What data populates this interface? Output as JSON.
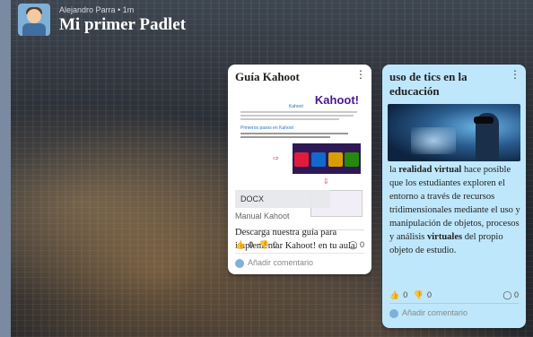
{
  "header": {
    "meta": "Alejandro Parra • 1m",
    "title": "Mi primer Padlet"
  },
  "cards": [
    {
      "title": "Guía Kahoot",
      "thumb_logo": "Kahoot!",
      "thumb_heading": "Kahoot",
      "thumb_sub": "Primeros pasos en Kahoot",
      "attachment_type": "DOCX",
      "attachment_name": "Manual Kahoot",
      "body": "Descarga nuestra guía para implementar Kahoot! en tu aula.",
      "likes": "0",
      "dislikes": "0",
      "comments": "0",
      "add_comment": "Añadir comentario"
    },
    {
      "title": "uso de tics en la educación",
      "body_parts": {
        "p1": "la ",
        "b1": "realidad virtual",
        "p2": " hace posible que los estudiantes exploren el entorno a través de recursos tridimensionales mediante el uso y manipulación de objetos, procesos y análisis ",
        "b2": "virtuales",
        "p3": " del propio objeto de estudio."
      },
      "likes": "0",
      "dislikes": "0",
      "comments": "0",
      "add_comment": "Añadir comentario"
    }
  ],
  "icons": {
    "menu": "more-vertical-icon",
    "like": "thumbs-up-icon",
    "dislike": "thumbs-down-icon",
    "comment": "comment-bubble-icon"
  },
  "colors": {
    "card2_bg": "#bfe7fb",
    "kahoot_purple": "#46178f"
  }
}
